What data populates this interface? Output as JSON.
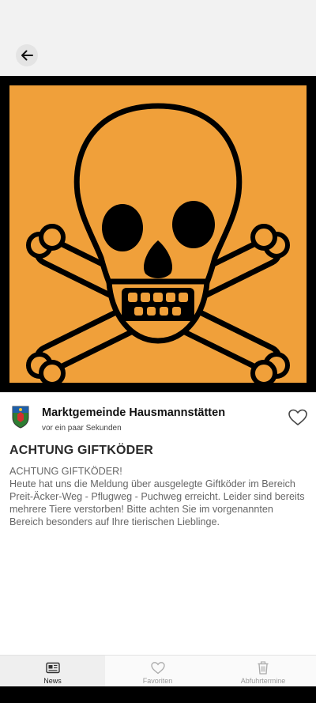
{
  "header": {
    "back_icon": "arrow-left-icon"
  },
  "hero": {
    "image": "toxic-skull-crossbones-hazard-symbol",
    "accent": "#f0a03a"
  },
  "author": {
    "name": "Marktgemeinde Hausmannstätten",
    "time": "vor ein paar Sekunden",
    "crest_icon": "municipal-crest-icon"
  },
  "post": {
    "title": "ACHTUNG GIFTKÖDER",
    "body_line1": "ACHTUNG GIFTKÖDER!",
    "body_text": "Heute hat uns die Meldung über ausgelegte Giftköder im Bereich Preit-Äcker-Weg - Pflugweg - Puchweg erreicht. Leider sind bereits mehrere Tiere verstorben! Bitte achten Sie im vorgenannten Bereich besonders auf Ihre tierischen Lieblinge."
  },
  "nav": {
    "items": [
      {
        "label": "News",
        "icon": "newspaper-icon",
        "active": true
      },
      {
        "label": "Favoriten",
        "icon": "heart-icon",
        "active": false
      },
      {
        "label": "Abfuhrtermine",
        "icon": "trash-bin-icon",
        "active": false
      }
    ]
  }
}
